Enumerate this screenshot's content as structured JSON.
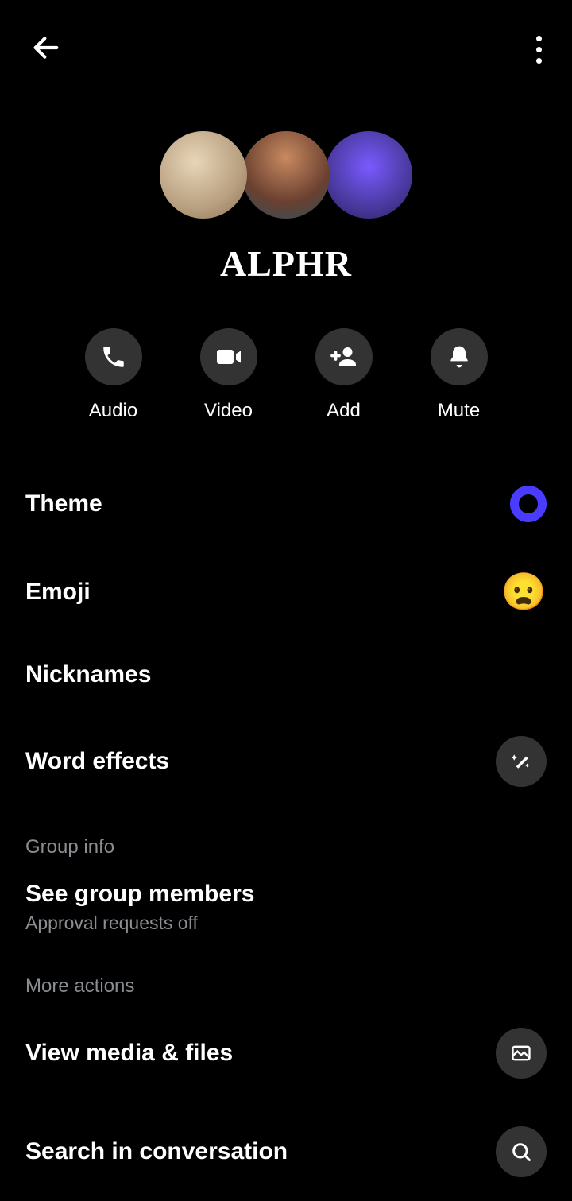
{
  "header": {
    "title": "ALPHR"
  },
  "actions": {
    "audio": "Audio",
    "video": "Video",
    "add": "Add",
    "mute": "Mute"
  },
  "settings": {
    "theme": "Theme",
    "emoji": "Emoji",
    "emoji_glyph": "😦",
    "nicknames": "Nicknames",
    "word_effects": "Word effects"
  },
  "group_info": {
    "header": "Group info",
    "see_members": "See group members",
    "approval_status": "Approval requests off"
  },
  "more_actions": {
    "header": "More actions",
    "view_media": "View media & files",
    "search": "Search in conversation"
  }
}
